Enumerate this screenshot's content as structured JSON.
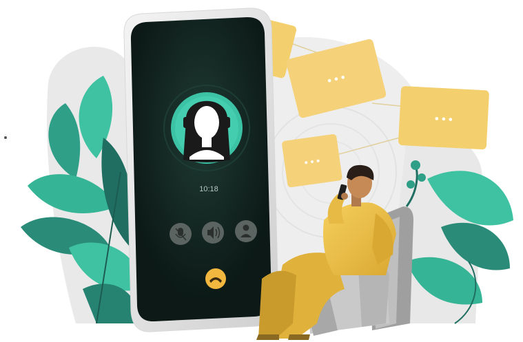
{
  "call": {
    "timer": "10:18",
    "controls": [
      "mute-icon",
      "speaker-icon",
      "add-contact-icon"
    ],
    "end_call_icon": "end-call-icon"
  },
  "chat_bubbles": [
    {
      "text": "• • •"
    },
    {
      "text": "• • •"
    },
    {
      "text": "• • •"
    },
    {
      "text": "• • •"
    }
  ],
  "colors": {
    "phone_screen": "#0f1f1b",
    "accent_teal": "#3cc3a6",
    "bubble_yellow": "#f3cf6d",
    "end_call": "#f2b73f",
    "shirt_yellow": "#f2c34b",
    "chair_gray": "#bfbfbf"
  }
}
